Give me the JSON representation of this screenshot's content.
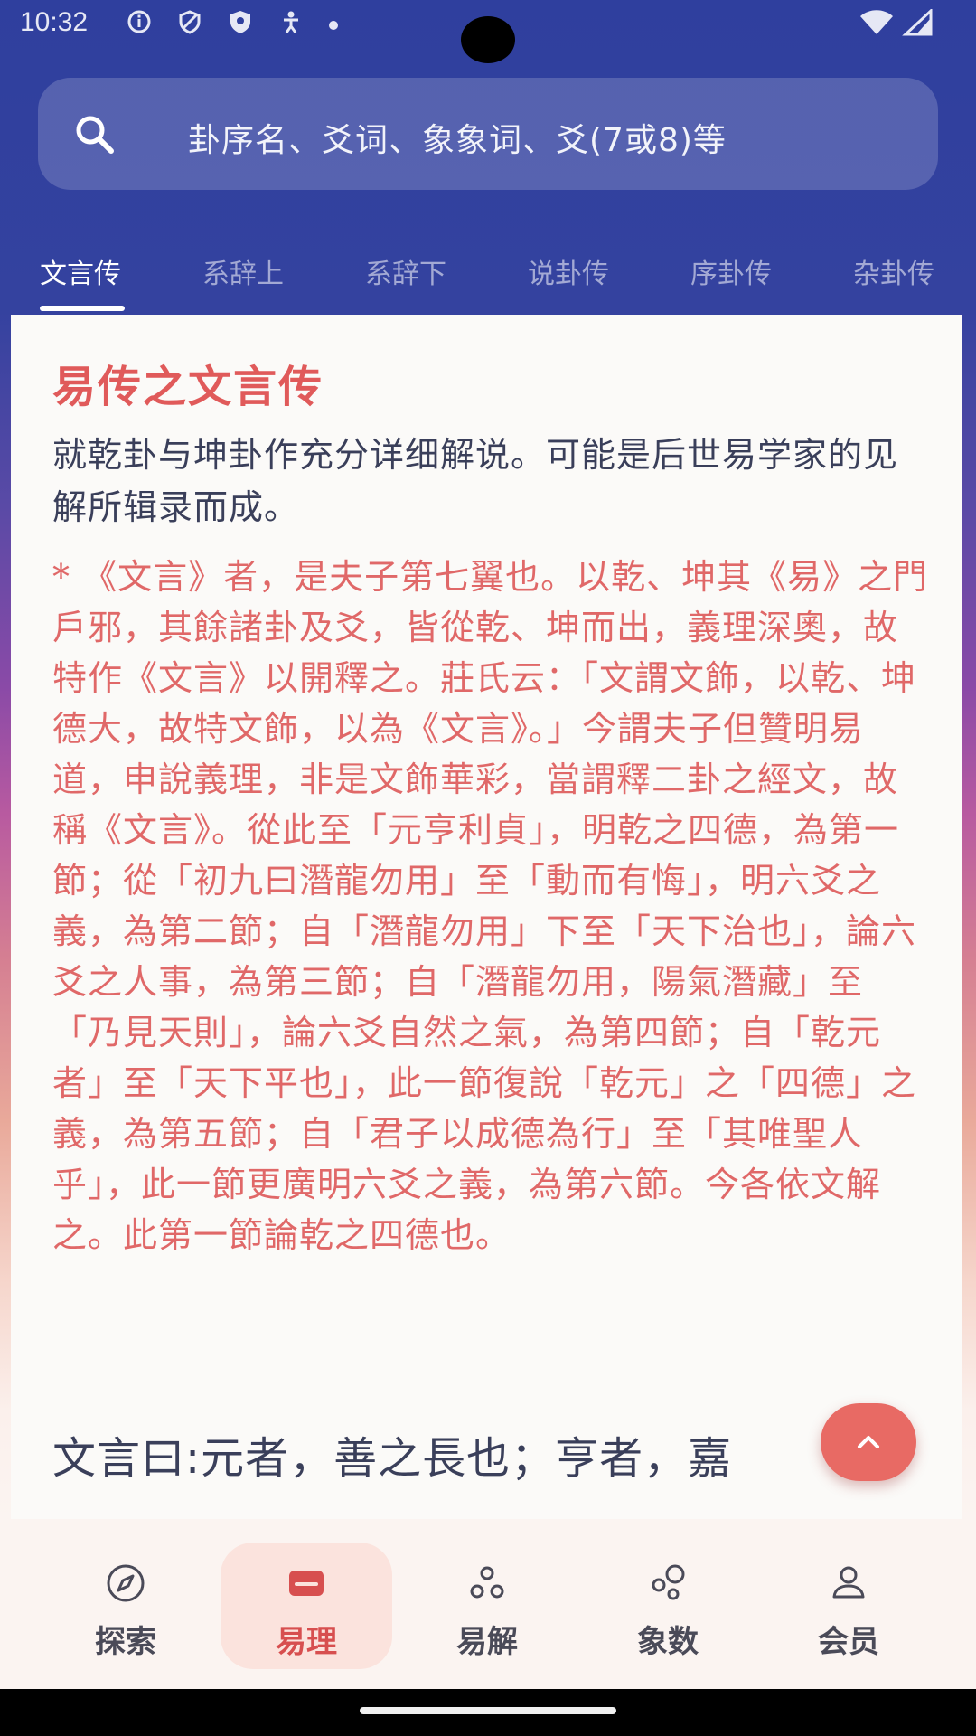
{
  "status_bar": {
    "time": "10:32"
  },
  "search": {
    "placeholder": "卦序名、爻词、象象词、爻(7或8)等"
  },
  "tabs": [
    {
      "label": "文言传",
      "active": true
    },
    {
      "label": "系辞上",
      "active": false
    },
    {
      "label": "系辞下",
      "active": false
    },
    {
      "label": "说卦传",
      "active": false
    },
    {
      "label": "序卦传",
      "active": false
    },
    {
      "label": "杂卦传",
      "active": false
    }
  ],
  "article": {
    "title": "易传之文言传",
    "summary": "就乾卦与坤卦作充分详细解说。可能是后世易学家的见解所辑录而成。",
    "commentary": "* 《文言》者，是夫子第七翼也。以乾、坤其《易》之門戶邪，其餘諸卦及爻，皆從乾、坤而出，義理深奧，故特作《文言》以開釋之。莊氏云：「文謂文飾，以乾、坤德大，故特文飾，以為《文言》。」今謂夫子但贊明易道，申說義理，非是文飾華彩，當謂釋二卦之經文，故稱《文言》。從此至「元亨利貞」，明乾之四德，為第一節；從「初九曰潛龍勿用」至「動而有悔」，明六爻之義，為第二節；自「潛龍勿用」下至「天下治也」，論六爻之人事，為第三節；自「潛龍勿用，陽氣潛藏」至「乃見天則」，論六爻自然之氣，為第四節；自「乾元者」至「天下平也」，此一節復說「乾元」之「四德」之義，為第五節；自「君子以成德為行」至「其唯聖人乎」，此一節更廣明六爻之義，為第六節。今各依文解之。此第一節論乾之四德也。",
    "main_text": "文言曰:元者，善之長也；亨者，嘉"
  },
  "bottom_nav": [
    {
      "label": "探索",
      "icon": "compass-icon",
      "active": false
    },
    {
      "label": "易理",
      "icon": "card-icon",
      "active": true
    },
    {
      "label": "易解",
      "icon": "circles-icon",
      "active": false
    },
    {
      "label": "象数",
      "icon": "bubbles-icon",
      "active": false
    },
    {
      "label": "会员",
      "icon": "person-icon",
      "active": false
    }
  ],
  "colors": {
    "accent": "#e05a5a",
    "header": "#2f3f9e",
    "text": "#3a3f5a"
  }
}
